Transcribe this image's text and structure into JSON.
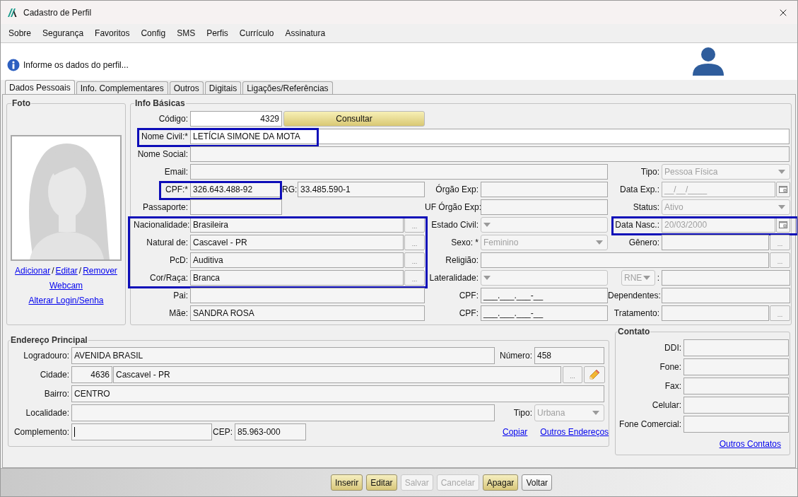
{
  "window": {
    "title": "Cadastro de Perfil"
  },
  "menu": [
    "Sobre",
    "Segurança",
    "Favoritos",
    "Config",
    "SMS",
    "Perfis",
    "Currículo",
    "Assinatura"
  ],
  "header": {
    "message": "Informe os dados do perfil..."
  },
  "tabs": [
    {
      "label": "Dados Pessoais",
      "selected": true
    },
    {
      "label": "Info. Complementares",
      "selected": false
    },
    {
      "label": "Outros",
      "selected": false
    },
    {
      "label": "Digitais",
      "selected": false
    },
    {
      "label": "Ligações/Referências",
      "selected": false
    }
  ],
  "foto": {
    "title": "Foto",
    "links": [
      {
        "kind": "link",
        "text": "Adicionar"
      },
      {
        "kind": "separator",
        "text": "/"
      },
      {
        "kind": "link",
        "text": "Editar"
      },
      {
        "kind": "separator",
        "text": "/"
      },
      {
        "kind": "link",
        "text": "Remover"
      }
    ],
    "more_links": [
      "Webcam",
      "Alterar Login/Senha"
    ]
  },
  "info_basicas": {
    "title": "Info Básicas",
    "rows": [
      {
        "cells": [
          {
            "label": "Código:",
            "value": "4329",
            "kind": "code",
            "editable": true
          },
          {
            "value": "Consultar",
            "kind": "button"
          }
        ]
      },
      {
        "cells": [
          {
            "label": "Nome Civil:*",
            "value": "LETÍCIA SIMONE DA MOTA",
            "kind": "text",
            "editable": true,
            "highlighted": true
          }
        ]
      },
      {
        "cells": [
          {
            "label": "Nome Social:",
            "kind": "text"
          }
        ]
      },
      {
        "cells": [
          {
            "label": "Email:",
            "kind": "text"
          },
          {
            "label": "Tipo:",
            "value": "Pessoa Física",
            "kind": "select",
            "disabled": true
          }
        ]
      },
      {
        "cells": [
          {
            "label": "CPF:*",
            "value": "326.643.488-92",
            "kind": "text",
            "highlighted": true
          },
          {
            "label": "RG:",
            "value": "33.485.590-1",
            "kind": "text"
          },
          {
            "label": "Órgão Exp:",
            "kind": "text"
          },
          {
            "label": "Data Exp.:",
            "value": "__/__/____",
            "kind": "date",
            "disabled": true
          }
        ]
      },
      {
        "cells": [
          {
            "label": "Passaporte:",
            "kind": "text"
          },
          {
            "label": "UF Órgão Exp:",
            "kind": "text"
          },
          {
            "label": "Status:",
            "value": "Ativo",
            "kind": "select",
            "disabled": true
          }
        ]
      },
      {
        "cells": [
          {
            "label": "Nacionalidade:",
            "value": "Brasileira",
            "kind": "lookup",
            "action": "...",
            "highlighted": true
          },
          {
            "label": "Estado Civil:",
            "kind": "select",
            "disabled": true
          },
          {
            "label": "Data Nasc.:",
            "value": "20/03/2000",
            "kind": "date",
            "disabled": true,
            "highlighted": true
          }
        ]
      },
      {
        "cells": [
          {
            "label": "Natural de:",
            "value": "Cascavel - PR",
            "kind": "lookup",
            "action": "...",
            "highlighted": true
          },
          {
            "label": "Sexo: *",
            "value": "Feminino",
            "kind": "select",
            "disabled": true
          },
          {
            "label": "Gênero:",
            "kind": "lookup",
            "action": "..."
          }
        ]
      },
      {
        "cells": [
          {
            "label": "PcD:",
            "value": "Auditiva",
            "kind": "lookup",
            "action": "...",
            "highlighted": true
          },
          {
            "label": "Religião:",
            "kind": "lookup",
            "action": "..."
          }
        ]
      },
      {
        "cells": [
          {
            "label": "Cor/Raça:",
            "value": "Branca",
            "kind": "lookup",
            "action": "...",
            "highlighted": true
          },
          {
            "label": "Lateralidade:",
            "kind": "select",
            "disabled": true
          },
          {
            "value": "RNE",
            "kind": "select",
            "disabled": true
          },
          {
            "label": ":",
            "kind": "text"
          }
        ]
      },
      {
        "cells": [
          {
            "label": "Pai:",
            "kind": "text"
          },
          {
            "label": "CPF:",
            "value": "___.___.___-__",
            "kind": "text"
          },
          {
            "label": "Dependentes:",
            "kind": "text"
          }
        ]
      },
      {
        "cells": [
          {
            "label": "Mãe:",
            "value": "SANDRA ROSA",
            "kind": "text"
          },
          {
            "label": "CPF:",
            "value": "___.___.___-__",
            "kind": "text"
          },
          {
            "label": "Tratamento:",
            "kind": "lookup",
            "action": "..."
          }
        ]
      }
    ]
  },
  "endereco": {
    "title": "Endereço Principal",
    "lines": [
      {
        "fields": [
          {
            "label": "Logradouro:",
            "value": "AVENIDA BRASIL",
            "kind": "text"
          },
          {
            "label": "Número:",
            "value": "458",
            "kind": "text"
          }
        ]
      },
      {
        "fields": [
          {
            "label": "Cidade:",
            "value": "4636",
            "kind": "code"
          },
          {
            "value": "Cascavel - PR",
            "kind": "text"
          },
          {
            "value": "...",
            "kind": "button"
          },
          {
            "kind": "edit"
          }
        ]
      },
      {
        "fields": [
          {
            "label": "Bairro:",
            "value": "CENTRO",
            "kind": "text"
          }
        ]
      },
      {
        "fields": [
          {
            "label": "Localidade:",
            "kind": "text"
          },
          {
            "label": "Tipo:",
            "value": "Urbana",
            "kind": "select",
            "disabled": true
          }
        ]
      },
      {
        "fields": [
          {
            "label": "Complemento:",
            "kind": "text",
            "focused": true
          },
          {
            "label": "CEP:",
            "value": "85.963-000",
            "kind": "text"
          },
          {
            "value": "Copiar",
            "kind": "link"
          },
          {
            "value": "Outros Endereços",
            "kind": "link"
          }
        ]
      }
    ]
  },
  "contato": {
    "title": "Contato",
    "fields": [
      {
        "label": "DDI:"
      },
      {
        "label": "Fone:"
      },
      {
        "label": "Fax:"
      },
      {
        "label": "Celular:"
      },
      {
        "label": "Fone Comercial:"
      }
    ],
    "link": "Outros Contatos"
  },
  "buttons": [
    {
      "label": "Inserir",
      "kind": "primary",
      "disabled": false
    },
    {
      "label": "Editar",
      "kind": "primary",
      "disabled": false
    },
    {
      "label": "Salvar",
      "kind": "primary",
      "disabled": true
    },
    {
      "label": "Cancelar",
      "kind": "primary",
      "disabled": true
    },
    {
      "label": "Apagar",
      "kind": "primary",
      "disabled": false
    },
    {
      "label": "Voltar",
      "kind": "default",
      "disabled": false
    }
  ]
}
